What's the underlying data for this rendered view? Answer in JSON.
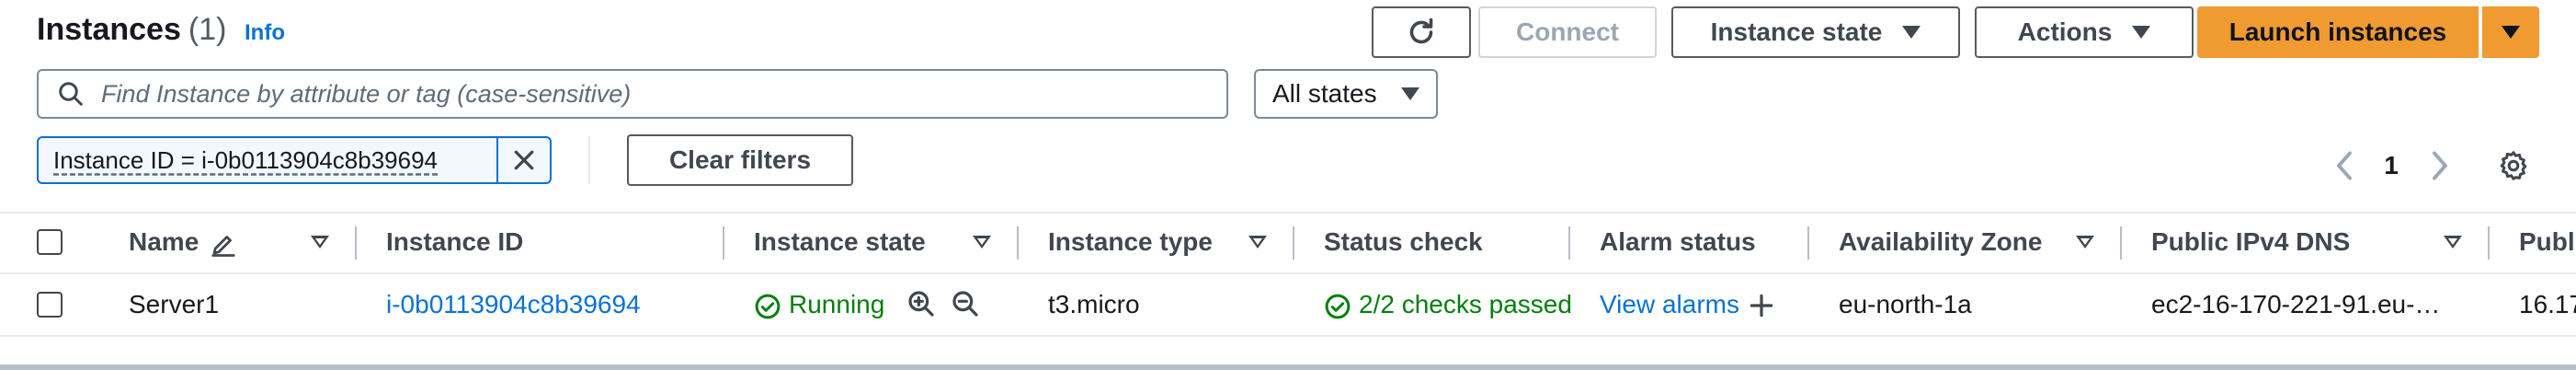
{
  "header": {
    "title": "Instances",
    "count": "(1)",
    "info_link": "Info"
  },
  "toolbar": {
    "refresh_icon": "refresh-icon",
    "connect_label": "Connect",
    "instance_state_label": "Instance state",
    "actions_label": "Actions",
    "launch_label": "Launch instances"
  },
  "search": {
    "placeholder": "Find Instance by attribute or tag (case-sensitive)",
    "value": ""
  },
  "state_filter": {
    "selected": "All states"
  },
  "filter_token": {
    "label": "Instance ID = i-0b0113904c8b39694"
  },
  "clear_filters_label": "Clear filters",
  "pagination": {
    "current_page": "1"
  },
  "table": {
    "columns": [
      "Name",
      "Instance ID",
      "Instance state",
      "Instance type",
      "Status check",
      "Alarm status",
      "Availability Zone",
      "Public IPv4 DNS",
      "Publ"
    ],
    "rows": [
      {
        "name": "Server1",
        "instance_id": "i-0b0113904c8b39694",
        "instance_state": "Running",
        "instance_type": "t3.micro",
        "status_check": "2/2 checks passed",
        "alarm_status": "View alarms",
        "availability_zone": "eu-north-1a",
        "public_dns": "ec2-16-170-221-91.eu-…",
        "public_ip": "16.17"
      }
    ]
  },
  "colors": {
    "accent": "#0972d3",
    "primary_button": "#f09a32",
    "success": "#037f0c",
    "text": "#16191f"
  }
}
